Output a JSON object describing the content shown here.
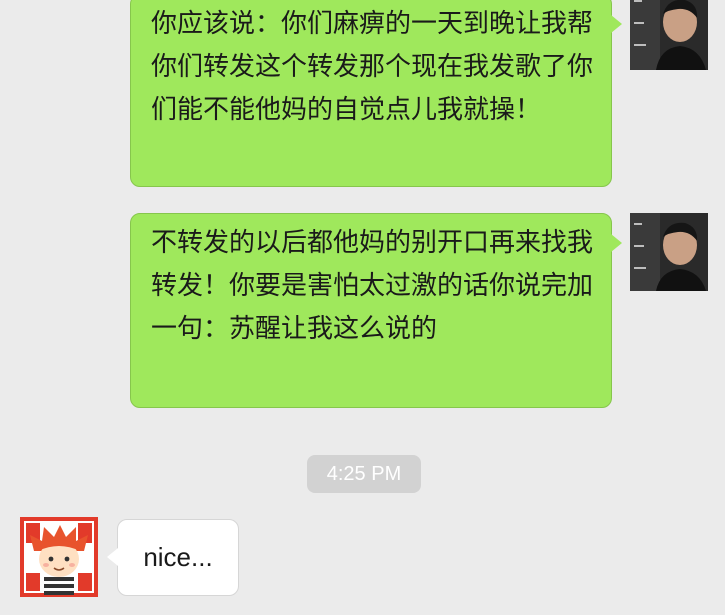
{
  "chat": {
    "messages": [
      {
        "direction": "sent",
        "text": "你应该说：你们麻痹的一天到晚让我帮你们转发这个转发那个现在我发歌了你们能不能他妈的自觉点儿我就操！",
        "avatar": "avatar-photo-icon"
      },
      {
        "direction": "sent",
        "text": "不转发的以后都他妈的别开口再来找我转发！你要是害怕太过激的话你说完加一句：苏醒让我这么说的",
        "avatar": "avatar-photo-icon"
      },
      {
        "direction": "received",
        "text": "nice...",
        "avatar": "cartoon-boy-avatar-icon"
      }
    ],
    "timestamp": "4:25 PM"
  },
  "colors": {
    "background": "#ebebeb",
    "sent_bubble": "#9fe85c",
    "received_bubble": "#ffffff",
    "timestamp_pill": "#d2d2d2",
    "avatar_frame": "#e23a2a"
  }
}
